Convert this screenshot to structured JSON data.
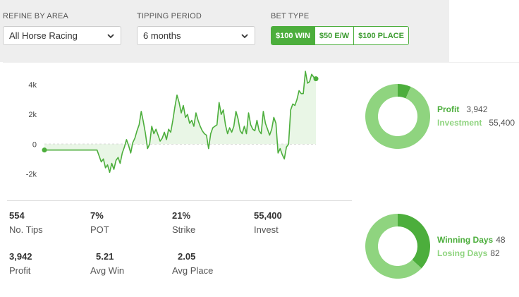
{
  "filters": {
    "area": {
      "label": "REFINE BY AREA",
      "value": "All Horse Racing"
    },
    "period": {
      "label": "TIPPING PERIOD",
      "value": "6 months"
    },
    "bet_type": {
      "label": "BET TYPE",
      "options": [
        "$100 WIN",
        "$50 E/W",
        "$100 PLACE"
      ],
      "active": "$100 WIN"
    }
  },
  "colors": {
    "green": "#4cae3c",
    "light_green": "#8fd47f",
    "fill": "#e9f6e6"
  },
  "chart_data": {
    "type": "area",
    "y_ticks": [
      "4k",
      "2k",
      "0",
      "-2k"
    ],
    "ylim": [
      -2600,
      5000
    ],
    "x": [
      0,
      1,
      2,
      3,
      4,
      5,
      6,
      7,
      8,
      9,
      10,
      11,
      12,
      13,
      14,
      15,
      16,
      17,
      18,
      19,
      20,
      21,
      22,
      23,
      24,
      25,
      26,
      27,
      28,
      29,
      30,
      31,
      32,
      33,
      34,
      35,
      36,
      37,
      38,
      39,
      40,
      41,
      42,
      43,
      44,
      45,
      46,
      47,
      48,
      49,
      50,
      51,
      52,
      53,
      54,
      55,
      56,
      57,
      58,
      59,
      60,
      61,
      62,
      63,
      64,
      65,
      66,
      67,
      68,
      69,
      70,
      71,
      72,
      73,
      74,
      75,
      76,
      77,
      78,
      79,
      80,
      81,
      82,
      83,
      84,
      85,
      86,
      87,
      88,
      89,
      90,
      91,
      92,
      93,
      94,
      95,
      96,
      97,
      98,
      99,
      100,
      101,
      102,
      103,
      104,
      105,
      106,
      107,
      108,
      109,
      110,
      111,
      112,
      113,
      114,
      115,
      116,
      117,
      118,
      119,
      120,
      121,
      122,
      123,
      124,
      125,
      126,
      127,
      128,
      129
    ],
    "y": [
      -400,
      -400,
      -400,
      -400,
      -400,
      -400,
      -400,
      -400,
      -400,
      -400,
      -400,
      -400,
      -400,
      -400,
      -400,
      -400,
      -400,
      -400,
      -400,
      -400,
      -400,
      -400,
      -400,
      -400,
      -400,
      -400,
      -800,
      -1200,
      -1000,
      -1600,
      -1400,
      -1900,
      -1300,
      -1700,
      -1100,
      -900,
      -1300,
      -600,
      -200,
      300,
      -100,
      -600,
      100,
      400,
      900,
      1300,
      2200,
      1500,
      700,
      -300,
      0,
      1200,
      700,
      1000,
      600,
      200,
      400,
      800,
      300,
      1000,
      800,
      1600,
      2500,
      3300,
      2800,
      2100,
      2600,
      1800,
      2000,
      1400,
      1600,
      1200,
      2100,
      1600,
      1200,
      900,
      700,
      600,
      -300,
      700,
      1100,
      1200,
      1300,
      2800,
      2000,
      2300,
      1300,
      700,
      1100,
      800,
      1200,
      2200,
      1700,
      900,
      700,
      1200,
      700,
      2100,
      1300,
      1000,
      900,
      1600,
      900,
      700,
      2200,
      1400,
      1000,
      600,
      1000,
      1800,
      1400,
      -600,
      -300,
      -700,
      -1000,
      -200,
      0,
      2300,
      2700,
      2600,
      3000,
      3600,
      3400,
      3400,
      4900,
      4100,
      4200,
      4700,
      4500,
      4400,
      3500,
      4000,
      3700,
      3900
    ]
  },
  "stats": [
    {
      "value": "554",
      "label": "No. Tips"
    },
    {
      "value": "7%",
      "label": "POT"
    },
    {
      "value": "21%",
      "label": "Strike"
    },
    {
      "value": "55,400",
      "label": "Invest"
    },
    {
      "value": "3,942",
      "label": "Profit"
    },
    {
      "value": "5.21",
      "label": "Avg Win"
    },
    {
      "value": "2.05",
      "label": "Avg Place"
    }
  ],
  "profit_donut": {
    "items": [
      {
        "name": "Profit",
        "value": "3,942",
        "amount": 3942
      },
      {
        "name": "Investment",
        "value": "55,400",
        "amount": 55400
      }
    ]
  },
  "days_donut": {
    "items": [
      {
        "name": "Winning Days",
        "value": "48",
        "amount": 48
      },
      {
        "name": "Losing Days",
        "value": "82",
        "amount": 82
      }
    ]
  }
}
